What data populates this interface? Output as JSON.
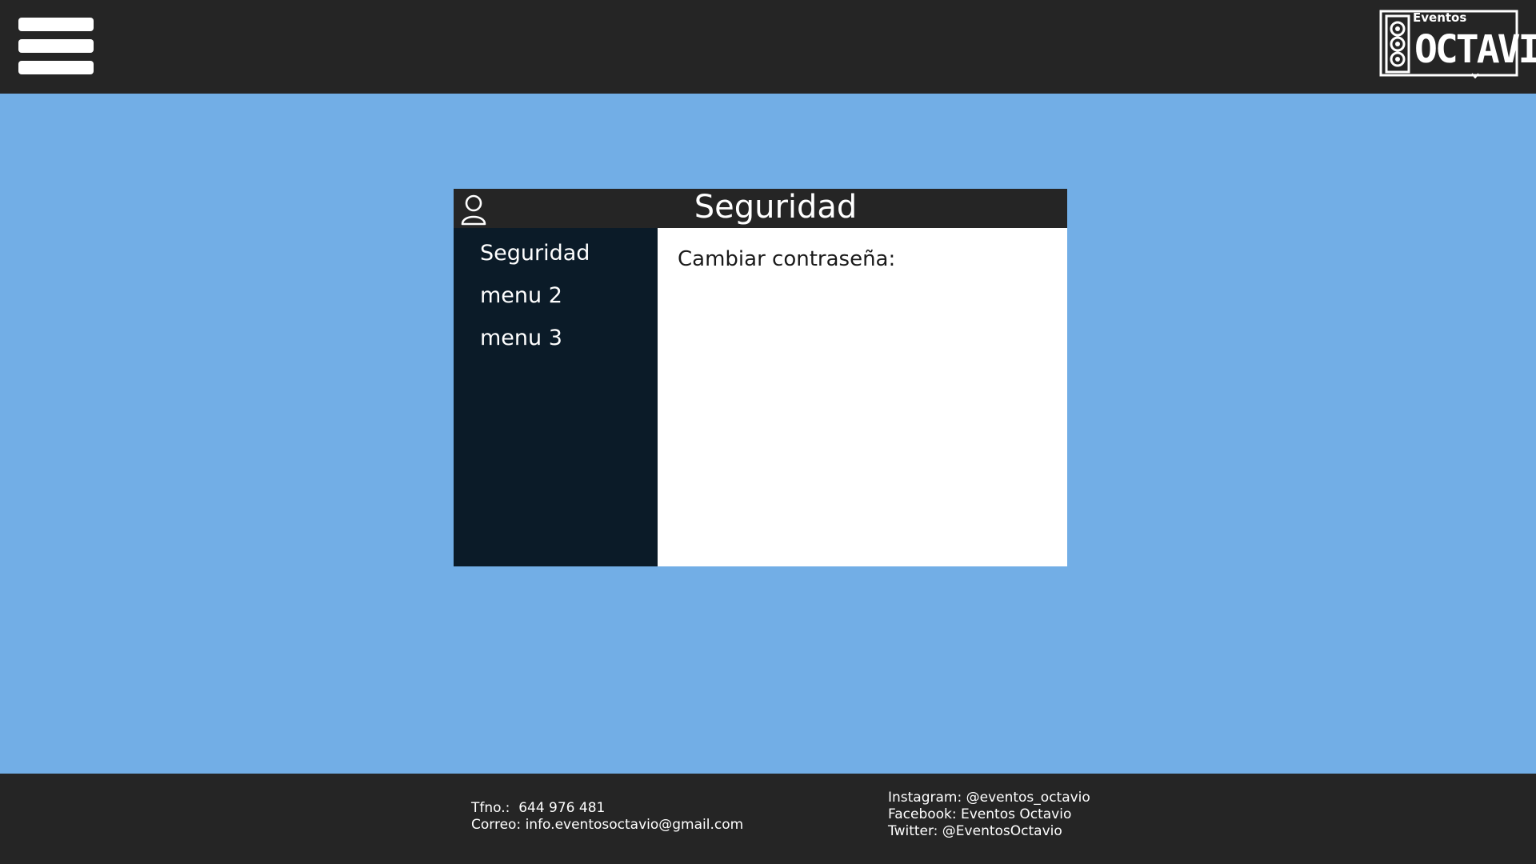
{
  "header": {
    "menu_icon": "hamburger-menu-icon",
    "logo": {
      "small_text": "Eventos",
      "main_text": "OCTAVIO"
    }
  },
  "card": {
    "title": "Seguridad",
    "title_icon": "user-icon",
    "menu": [
      {
        "label": "Seguridad"
      },
      {
        "label": "menu 2"
      },
      {
        "label": "menu 3"
      }
    ],
    "content": {
      "label": "Cambiar contraseña:"
    }
  },
  "footer": {
    "phone_label": "Tfno.:",
    "phone": "644 976 481",
    "email_label": "Correo:",
    "email": "info.eventosoctavio@gmail.com",
    "instagram": "Instagram: @eventos_octavio",
    "facebook": "Facebook: Eventos Octavio",
    "twitter": "Twitter: @EventosOctavio"
  },
  "colors": {
    "background": "#72aee6",
    "bars": "#252525",
    "side_menu": "#0b1b28",
    "content": "#ffffff"
  }
}
